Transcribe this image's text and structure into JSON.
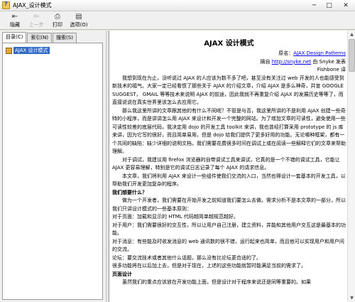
{
  "window": {
    "title": "AJAX_设计模式",
    "controls": {
      "minimize": "─",
      "maximize": "□",
      "close": "✕"
    }
  },
  "toolbar": {
    "items": [
      {
        "label": "隐藏",
        "icon": "hide-pane-icon",
        "glyph": "⇤",
        "enabled": true
      },
      {
        "label": "上一步",
        "icon": "back-arrow-icon",
        "glyph": "⇦",
        "enabled": false
      },
      {
        "label": "打印",
        "icon": "printer-icon",
        "glyph": "⎙",
        "enabled": true
      },
      {
        "label": "选项(O)",
        "icon": "options-icon",
        "glyph": "▤",
        "enabled": true
      }
    ]
  },
  "nav": {
    "tabs": [
      "目录(C)",
      "索引(N)",
      "搜索(S)"
    ],
    "active_tab": "目录(C)",
    "tree_item": "AJAX 设计模式"
  },
  "doc": {
    "title": "AJAX 设计模式",
    "author_prefix": "原名：",
    "author_link": "AJAX Design Patterns",
    "source_prefix": "摘自",
    "source_link": "http://snyke.net",
    "source_suffix": " 由 Snyke 发表",
    "translator": "Fishbone 译",
    "paragraphs": [
      "我想到现在为止，没听说过 AJAX 的人应该为数不多了吧，甚至没有关注过 web 开发的人也能感受到新技术的福气。大家一定已经看惯了那些关于 AJAX 的介绍文章，介绍 AJAX 是多么神奇，并宣 GOOGLE SUGGEST， GMAIL 等等技术来说明 AJAX 的前途，因此我就不再重复介绍 AJAX 的发展历史等等了，而直接说说在真实世界里该怎么去应用它。",
      "那么我这里所讲的文章跟其他的有什么不同呢？不管是与否，我这里所讲的不是利用 AJAX 创建一些奇特的小程序，而是讲讲怎么用 AJAX 来设计和开发一个完整的网站。为了增加文章的可读性，避免使用一些可读性较差的底层代码，我决定用 dojo 的开发工具 toolkit 来讲，我也曾经打算采用 prototype 的 js 库来讲，因为它写的很好，而且简单易用，但是 dojo 给我们提供了更多好用的功能。无论哪种框架，都有一个共同的缺陷：缺少详细的说明文档，我们需要花费很多时间在调试上或在阅读一些解释它们的文章来帮助理解。",
      "对于调试，我建议用 firefox 浏览器的自带调试工具来调试，它真的是一个不错的调试工具，它能让 AJAX 更容易理解，特别是它的调试日志记录了每个 AJAX 的请求信息。",
      "本文章，我们将利用 AJAX 来设计一些组件使我们交流的入口，当然也得设计一套基本的开发工具，以帮助我们开发更加复杂的程序。"
    ],
    "section1_heading": "我们想要什么？",
    "section1_intro": "做为一个开发者，我们需要在开始开发之前知道我们要怎么去做。需求分析不是本文章的一部分，所以我们只讲设计模式的一些基本原则：",
    "section1_items": [
      "对于页面：加载和显示的 HTML 代码越简单越规范越好。",
      "对于用户：我们需要很好的交互性，所以让用户自己注册，建立资料，并能和其他用户交互这是最基本的功能。",
      "对于消息：有些能及时收发消息的 web 通讯数的很不错，运行起来也简单，而且他可以实现用户和用户间的交流。",
      "论坛：要交流技术或者其他什么话题，那么没有比论坛更合适的了。",
      "很多功能将在以后加上去，但是对于现在，上述的这些功能就暂时能满足当前的需求了。"
    ],
    "section2_heading": "页面设计",
    "section2_text": "虽然我们的重点应该放在开发功能上面，但是设计对于程序来说还是同等重要的。如果"
  }
}
